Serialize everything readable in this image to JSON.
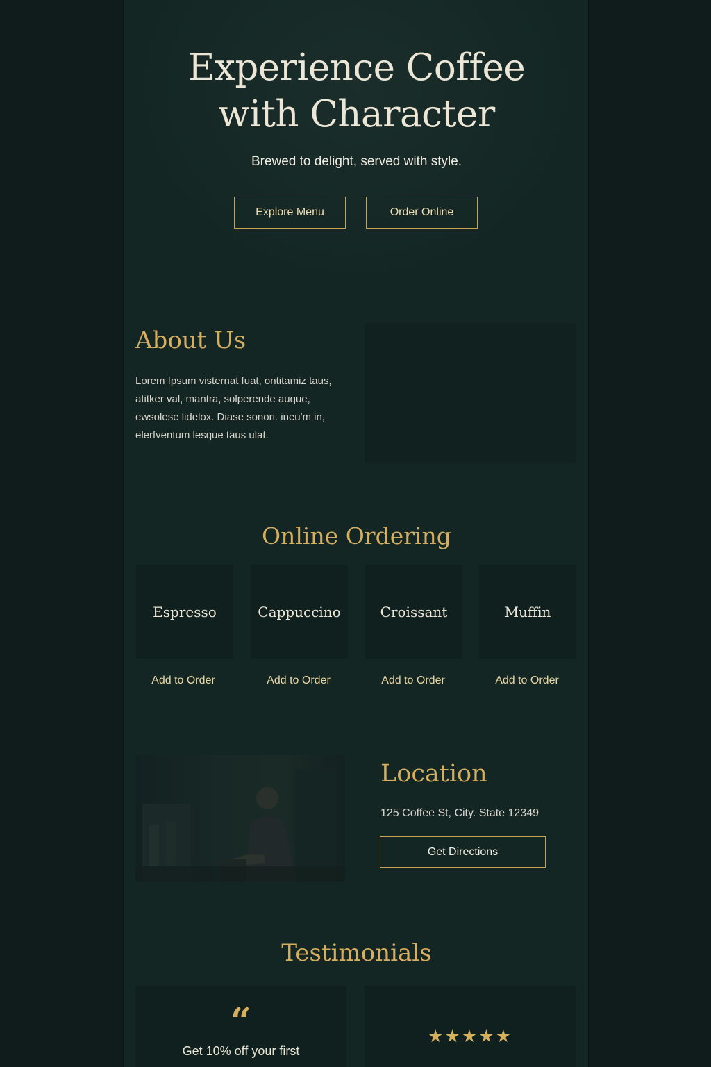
{
  "hero": {
    "title_line1": "Experience Coffee",
    "title_line2": "with Character",
    "subtitle": "Brewed to delight, served with style.",
    "explore_label": "Explore Menu",
    "order_label": "Order Online"
  },
  "about": {
    "title": "About Us",
    "text": "Lorem Ipsum visternat fuat, ontitamiz taus, atitker val, mantra, solperende auque, ewsolese lidelox. Diase sonori. ineu'm in, elerfventum lesque taus ulat."
  },
  "ordering": {
    "title": "Online Ordering",
    "items": [
      {
        "name": "Espresso",
        "action": "Add to Order"
      },
      {
        "name": "Cappuccino",
        "action": "Add to Order"
      },
      {
        "name": "Croissant",
        "action": "Add to Order"
      },
      {
        "name": "Muffin",
        "action": "Add to Order"
      }
    ]
  },
  "location": {
    "title": "Location",
    "address": "125 Coffee St, City. State 12349",
    "directions_label": "Get Directions"
  },
  "testimonials": {
    "title": "Testimonials",
    "quote_mark": "“",
    "card1_text": "Get 10% off your first",
    "stars": "★★★★★"
  },
  "colors": {
    "background": "#12201f",
    "accent_gold": "#d6ae5f",
    "text_light": "#ece6d6"
  }
}
